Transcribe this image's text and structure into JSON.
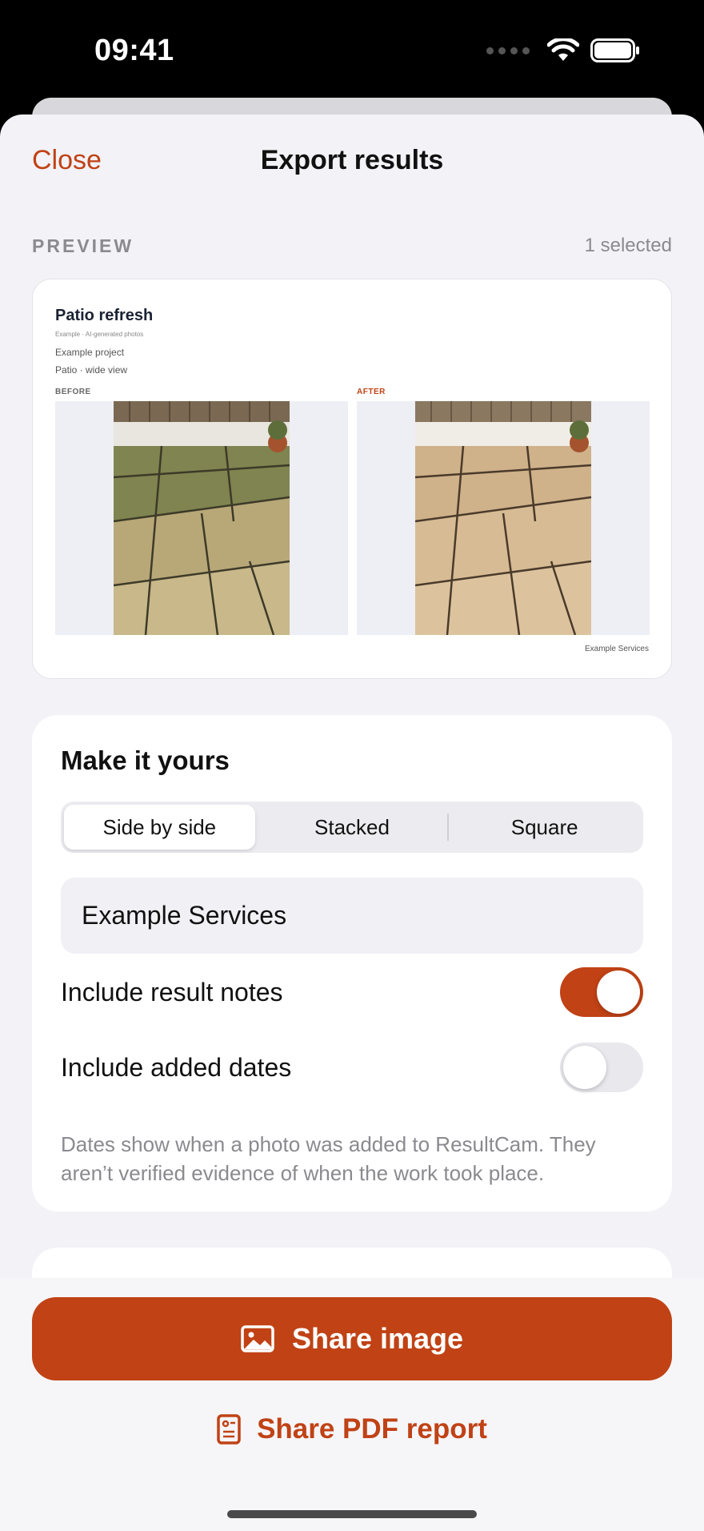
{
  "status_bar": {
    "time": "09:41"
  },
  "nav": {
    "close_label": "Close",
    "title": "Export results"
  },
  "preview_section": {
    "label": "PREVIEW",
    "selection_count": "1 selected"
  },
  "preview_card": {
    "title": "Patio refresh",
    "subtitle": "Example · AI-generated photos",
    "project": "Example project",
    "view": "Patio · wide view",
    "before_label": "BEFORE",
    "after_label": "AFTER",
    "footer": "Example Services"
  },
  "options": {
    "title": "Make it yours",
    "layouts": [
      "Side by side",
      "Stacked",
      "Square"
    ],
    "selected_layout": "Side by side",
    "business_name_value": "Example Services",
    "include_notes_label": "Include result notes",
    "include_notes_on": true,
    "include_dates_label": "Include added dates",
    "include_dates_on": false,
    "dates_note": "Dates show when a photo was added to ResultCam. They aren’t verified evidence of when the work took place."
  },
  "actions": {
    "share_image_label": "Share image",
    "share_pdf_label": "Share PDF report"
  },
  "icons": {
    "share_image": "photo-icon",
    "share_pdf": "document-icon"
  },
  "colors": {
    "accent": "#c04215",
    "background": "#f2f2f7"
  }
}
